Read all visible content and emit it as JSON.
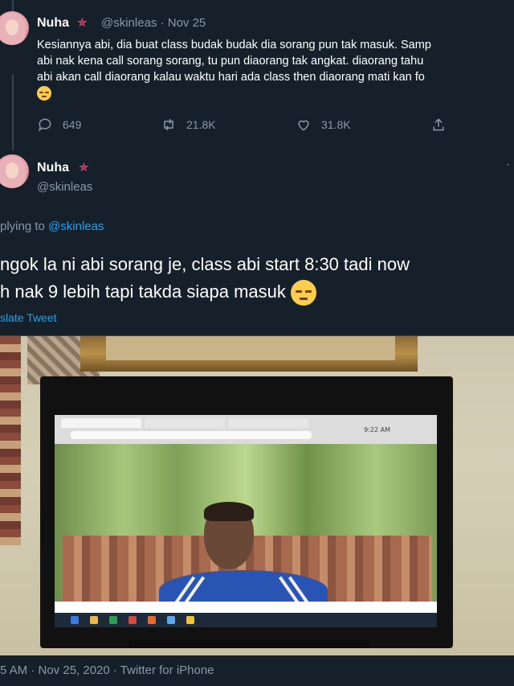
{
  "colors": {
    "background": "#15202b",
    "link": "#1da1f2",
    "muted": "#8899a6"
  },
  "first_tweet": {
    "name": "Nuha",
    "handle_date": "@skinleas · Nov 25",
    "lines": [
      "Kesiannya abi, dia buat class budak budak dia sorang pun tak masuk. Samp",
      "abi nak kena call sorang sorang, tu pun diaorang tak angkat. diaorang tahu",
      "abi akan call diaorang kalau waktu hari ada class then diaorang mati kan fo"
    ],
    "emoji": "pensive-face",
    "replies": "649",
    "retweets": "21.8K",
    "likes": "31.8K"
  },
  "main_tweet": {
    "name": "Nuha",
    "handle": "@skinleas",
    "replying_prefix": "plying to ",
    "replying_handle": "@skinleas",
    "line1": "ngok la ni abi sorang je, class abi start 8:30 tadi now",
    "line2": "h nak 9 lebih tapi takda siapa masuk",
    "emoji": "pensive-face",
    "translate": "slate Tweet",
    "screen_time": "9:22 AM",
    "meta": "5 AM · Nov 25, 2020 · Twitter for iPhone"
  }
}
